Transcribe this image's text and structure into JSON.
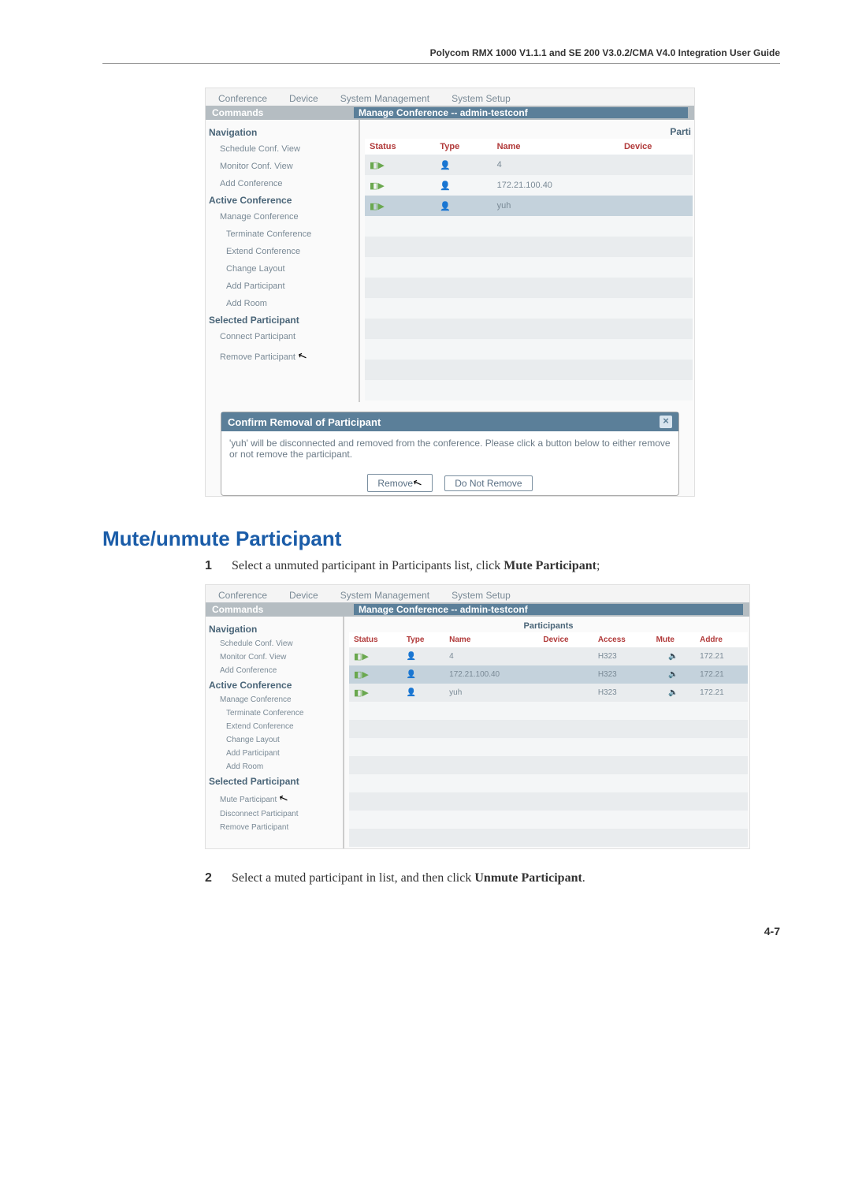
{
  "header": "Polycom RMX 1000 V1.1.1 and SE 200 V3.0.2/CMA V4.0 Integration User Guide",
  "tabs": {
    "conference": "Conference",
    "device": "Device",
    "sys_mgmt": "System Management",
    "sys_setup": "System Setup"
  },
  "commands_label": "Commands",
  "manage_conf_title": "Manage Conference -- admin-testconf",
  "sidebar": {
    "nav": "Navigation",
    "schedule": "Schedule Conf. View",
    "monitor": "Monitor Conf. View",
    "add_conf": "Add Conference",
    "active": "Active Conference",
    "manage": "Manage Conference",
    "terminate": "Terminate Conference",
    "extend": "Extend Conference",
    "change_layout": "Change Layout",
    "add_participant": "Add Participant",
    "add_room": "Add Room",
    "selected_p": "Selected Participant",
    "connect": "Connect Participant",
    "remove": "Remove Participant",
    "mute": "Mute Participant",
    "disconnect": "Disconnect Participant"
  },
  "table1": {
    "parti": "Parti",
    "hdr": {
      "status": "Status",
      "type": "Type",
      "name": "Name",
      "device": "Device"
    },
    "rows": [
      {
        "name": "4"
      },
      {
        "name": "172.21.100.40"
      },
      {
        "name": "yuh"
      }
    ]
  },
  "dialog": {
    "title": "Confirm Removal of Participant",
    "body": "'yuh' will be disconnected and removed from the conference.  Please click a button below to either remove or not remove the participant.",
    "remove": "Remove",
    "not_remove": "Do Not Remove"
  },
  "section_title": "Mute/unmute Participant",
  "step1": {
    "num": "1",
    "pre": "Select a unmuted participant in Participants list, click ",
    "bold": "Mute Participant",
    "post": ";"
  },
  "table2": {
    "participants": "Participants",
    "hdr": {
      "status": "Status",
      "type": "Type",
      "name": "Name",
      "device": "Device",
      "access": "Access",
      "mute": "Mute",
      "addr": "Addre"
    },
    "rows": [
      {
        "name": "4",
        "access": "H323",
        "addr": "172.21"
      },
      {
        "name": "172.21.100.40",
        "access": "H323",
        "addr": "172.21"
      },
      {
        "name": "yuh",
        "access": "H323",
        "addr": "172.21"
      }
    ]
  },
  "step2": {
    "num": "2",
    "pre": "Select a muted participant in list, and then click ",
    "bold": "Unmute Participant",
    "post": "."
  },
  "page_num": "4-7"
}
